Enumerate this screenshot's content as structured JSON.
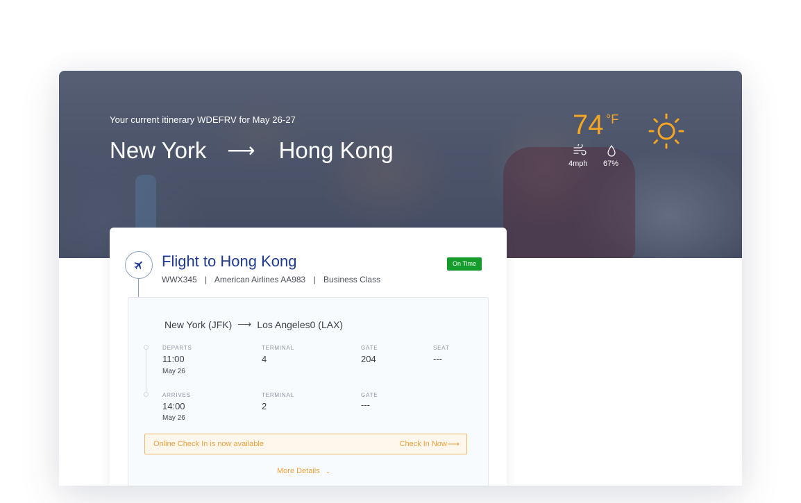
{
  "hero": {
    "itinerary_line": "Your current itinerary WDEFRV for May 26-27",
    "origin": "New York",
    "route_arrow": "⟶",
    "destination": "Hong Kong"
  },
  "weather": {
    "temperature": "74",
    "unit": "°F",
    "wind": "4mph",
    "humidity": "67%",
    "condition_icon": "sun-icon",
    "accent_color": "#f5a623"
  },
  "flight": {
    "title": "Flight to Hong Kong",
    "code": "WWX345",
    "airline": "American Airlines AA983",
    "class": "Business Class",
    "separator": "|",
    "status": "On Time",
    "status_color": "#159a2c",
    "segment": {
      "from": "New York (JFK)",
      "arrow": "⟶",
      "to": "Los Angeles0 (LAX)",
      "departs": {
        "label": "DEPARTS",
        "time": "11:00",
        "date": "May 26",
        "terminal_label": "TERMINAL",
        "terminal": "4",
        "gate_label": "GATE",
        "gate": "204",
        "seat_label": "SEAT",
        "seat": "---"
      },
      "arrives": {
        "label": "ARRIVES",
        "time": "14:00",
        "date": "May 26",
        "terminal_label": "TERMINAL",
        "terminal": "2",
        "gate_label": "GATE",
        "gate": "---"
      }
    },
    "checkin": {
      "message": "Online Check In is now available",
      "action": "Check In Now",
      "arrow": "⟶"
    },
    "more_details": "More Details",
    "more_chevron": "⌄"
  }
}
